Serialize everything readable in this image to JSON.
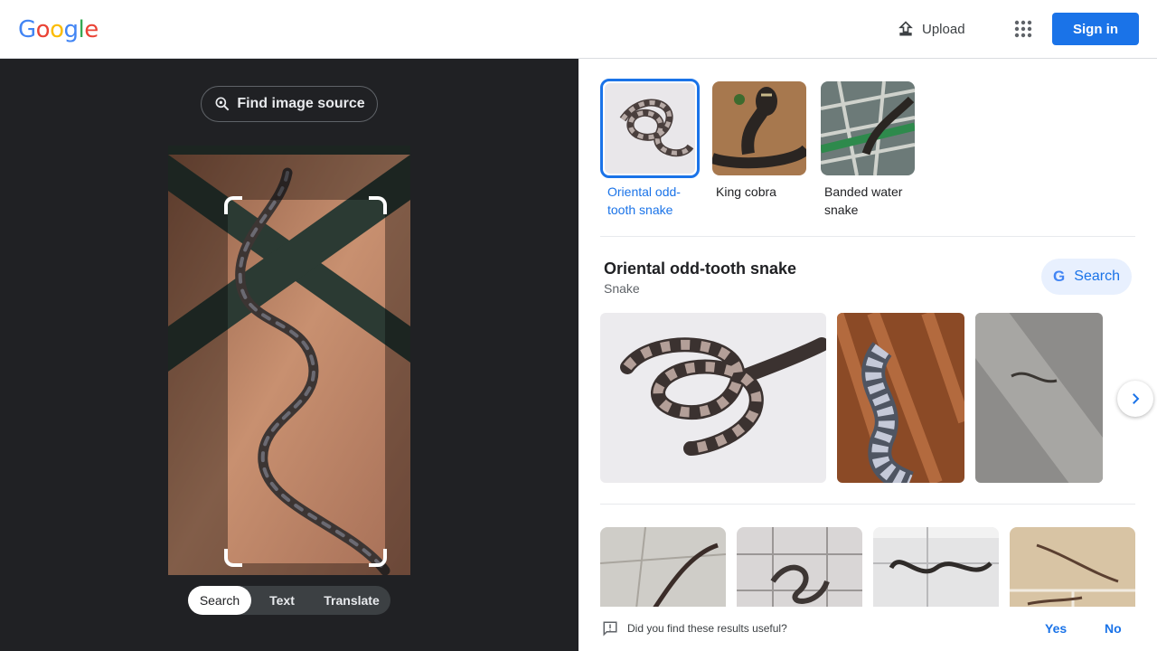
{
  "header": {
    "logo": [
      "G",
      "o",
      "o",
      "g",
      "l",
      "e"
    ],
    "logo_colors": [
      "#4285F4",
      "#EA4335",
      "#FBBC05",
      "#4285F4",
      "#34A853",
      "#EA4335"
    ],
    "upload_label": "Upload",
    "signin_label": "Sign in"
  },
  "lens": {
    "find_source_label": "Find image source",
    "modes": [
      "Search",
      "Text",
      "Translate"
    ],
    "active_mode": "Search"
  },
  "suggestions": [
    {
      "label": "Oriental odd-tooth snake",
      "selected": true
    },
    {
      "label": "King cobra",
      "selected": false
    },
    {
      "label": "Banded water snake",
      "selected": false
    }
  ],
  "result": {
    "title": "Oriental odd-tooth snake",
    "subtitle": "Snake",
    "search_label": "Search"
  },
  "feedback": {
    "question": "Did you find these results useful?",
    "yes": "Yes",
    "no": "No"
  },
  "colors": {
    "accent": "#1a73e8",
    "dark_panel": "#202124"
  }
}
